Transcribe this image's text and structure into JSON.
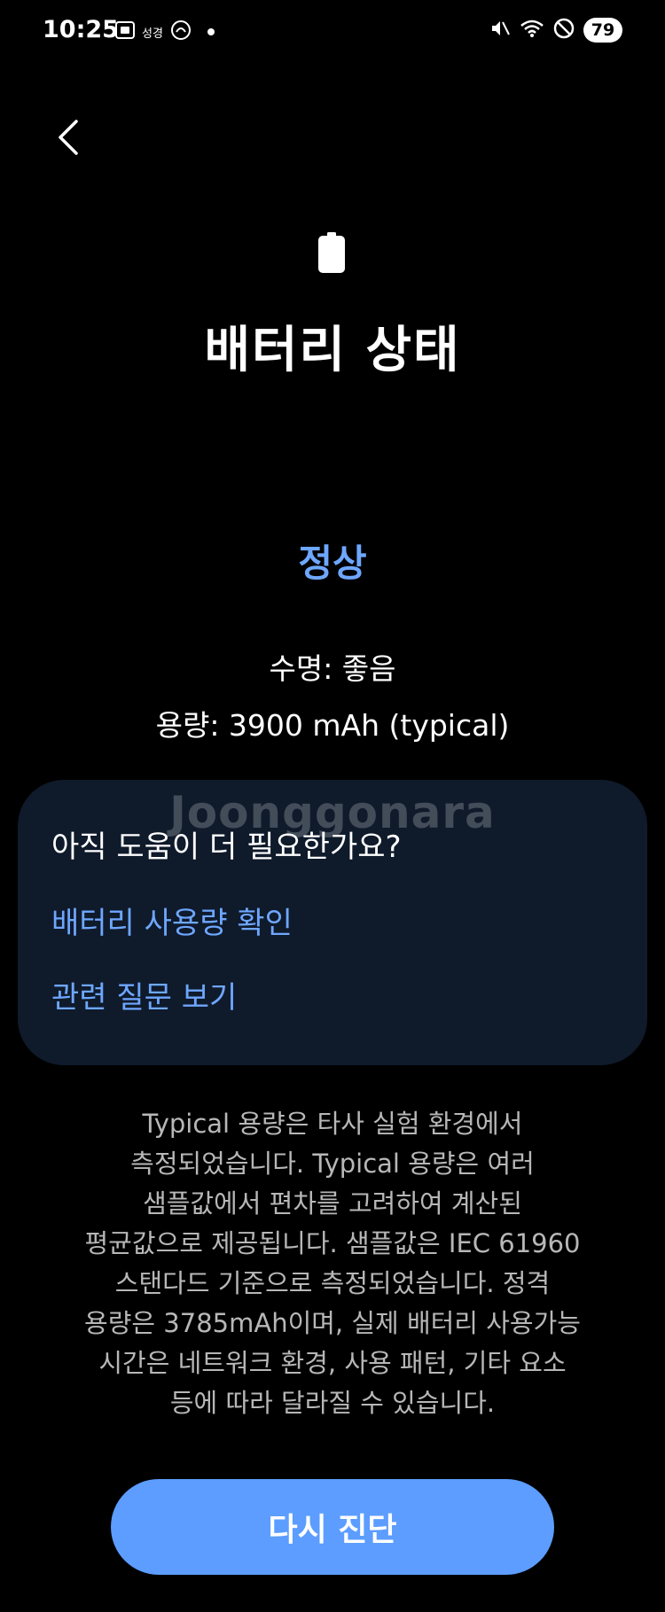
{
  "status_bar": {
    "time": "10:25",
    "app_label": "성경",
    "battery_level": "79"
  },
  "header": {
    "title": "배터리 상태"
  },
  "battery": {
    "status": "정상",
    "life": "수명: 좋음",
    "capacity": "용량: 3900 mAh (typical)"
  },
  "help_card": {
    "watermark": "Joonggonara",
    "title": "아직 도움이 더 필요한가요?",
    "links": [
      {
        "label": "배터리 사용량 확인"
      },
      {
        "label": "관련 질문 보기"
      }
    ]
  },
  "disclaimer": {
    "lines": [
      "Typical 용량은 타사 실험 환경에서",
      "측정되었습니다. Typical 용량은 여러",
      "샘플값에서 편차를 고려하여 계산된",
      "평균값으로 제공됩니다. 샘플값은 IEC 61960",
      "스탠다드 기준으로 측정되었습니다. 정격",
      "용량은 3785mAh이며, 실제 배터리 사용가능",
      "시간은 네트워크 환경, 사용 패턴, 기타 요소",
      "등에 따라 달라질 수 있습니다."
    ]
  },
  "actions": {
    "rediagnose_label": "다시 진단"
  },
  "colors": {
    "background": "#000000",
    "accent": "#6ea7ff",
    "button": "#5c9dff",
    "card": "#0f1a2b"
  }
}
